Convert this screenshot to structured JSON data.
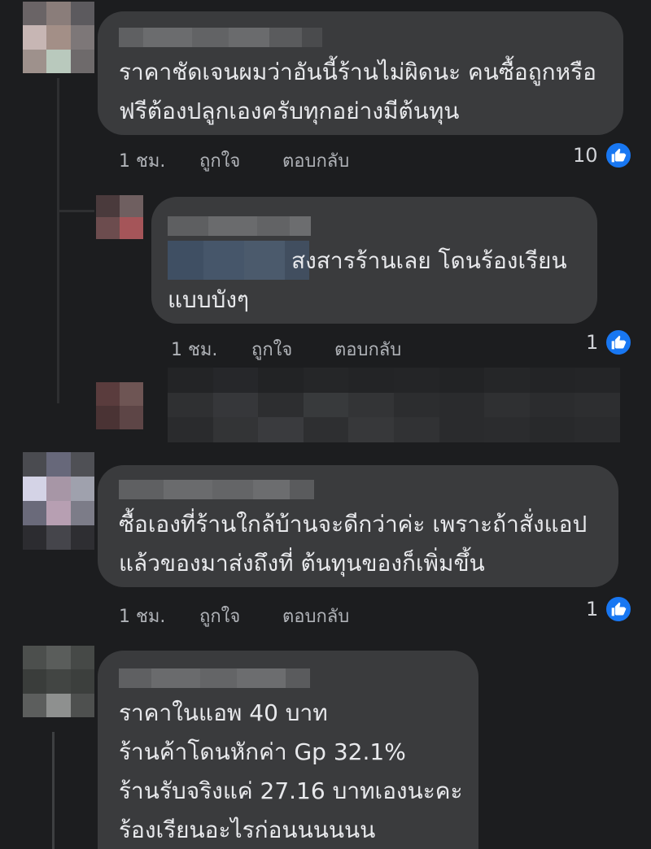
{
  "comments": [
    {
      "text_lines": [
        "ราคาชัดเจนผมว่าอันนี้ร้านไม่ผิดนะ คนซื้อถูกหรือ",
        "ฟรีต้องปลูกเองครับทุกอย่างมีต้นทุน"
      ],
      "time": "1 ชม.",
      "like_label": "ถูกใจ",
      "reply_label": "ตอบกลับ",
      "reaction_count": "10"
    },
    {
      "text_lines": [
        "สงสารร้านเลย โดนร้องเรียน",
        "แบบบังๆ"
      ],
      "time": "1 ชม.",
      "like_label": "ถูกใจ",
      "reply_label": "ตอบกลับ",
      "reaction_count": "1"
    },
    {
      "text_lines": [
        "ซื้อเองที่ร้านใกล้บ้านจะดีกว่าค่ะ เพราะถ้าสั่งแอป",
        "แล้วของมาส่งถึงที่ ต้นทุนของก็เพิ่มขึ้น"
      ],
      "time": "1 ชม.",
      "like_label": "ถูกใจ",
      "reply_label": "ตอบกลับ",
      "reaction_count": "1"
    },
    {
      "text_lines": [
        "ราคาในแอพ 40 บาท",
        "ร้านค้าโดนหักค่า Gp 32.1%",
        "ร้านรับจริงแค่ 27.16 บาทเองนะคะ",
        "ร้องเรียนอะไรก่อนนนนนน"
      ]
    }
  ],
  "colors": {
    "background": "#1c1d1f",
    "bubble": "#3a3b3d",
    "like_blue": "#1877f2"
  },
  "icons": [
    "thumbs-up-icon"
  ]
}
